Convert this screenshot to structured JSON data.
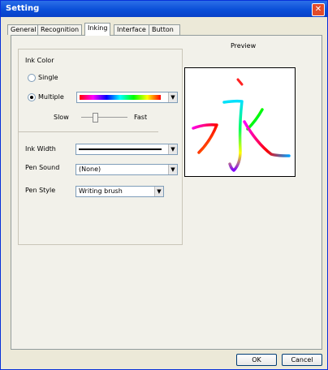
{
  "window": {
    "title": "Setting"
  },
  "tabs": [
    {
      "label": "General"
    },
    {
      "label": "Recognition"
    },
    {
      "label": "Inking"
    },
    {
      "label": "Interface"
    },
    {
      "label": "Button Options"
    }
  ],
  "inking": {
    "ink_color_label": "Ink Color",
    "single_label": "Single",
    "multiple_label": "Multiple",
    "selected_mode": "Multiple",
    "speed_slow_label": "Slow",
    "speed_fast_label": "Fast",
    "speed_level_percent": 30,
    "ink_width_label": "Ink Width",
    "pen_sound_label": "Pen Sound",
    "pen_sound_value": "(None)",
    "pen_style_label": "Pen Style",
    "pen_style_value": "Writing brush"
  },
  "preview": {
    "label": "Preview"
  },
  "buttons": {
    "ok": "OK",
    "cancel": "Cancel"
  },
  "colors": {
    "title_blue": "#0a4fd8",
    "close_red": "#e24b2a",
    "dialog_bg": "#ece9d8"
  }
}
